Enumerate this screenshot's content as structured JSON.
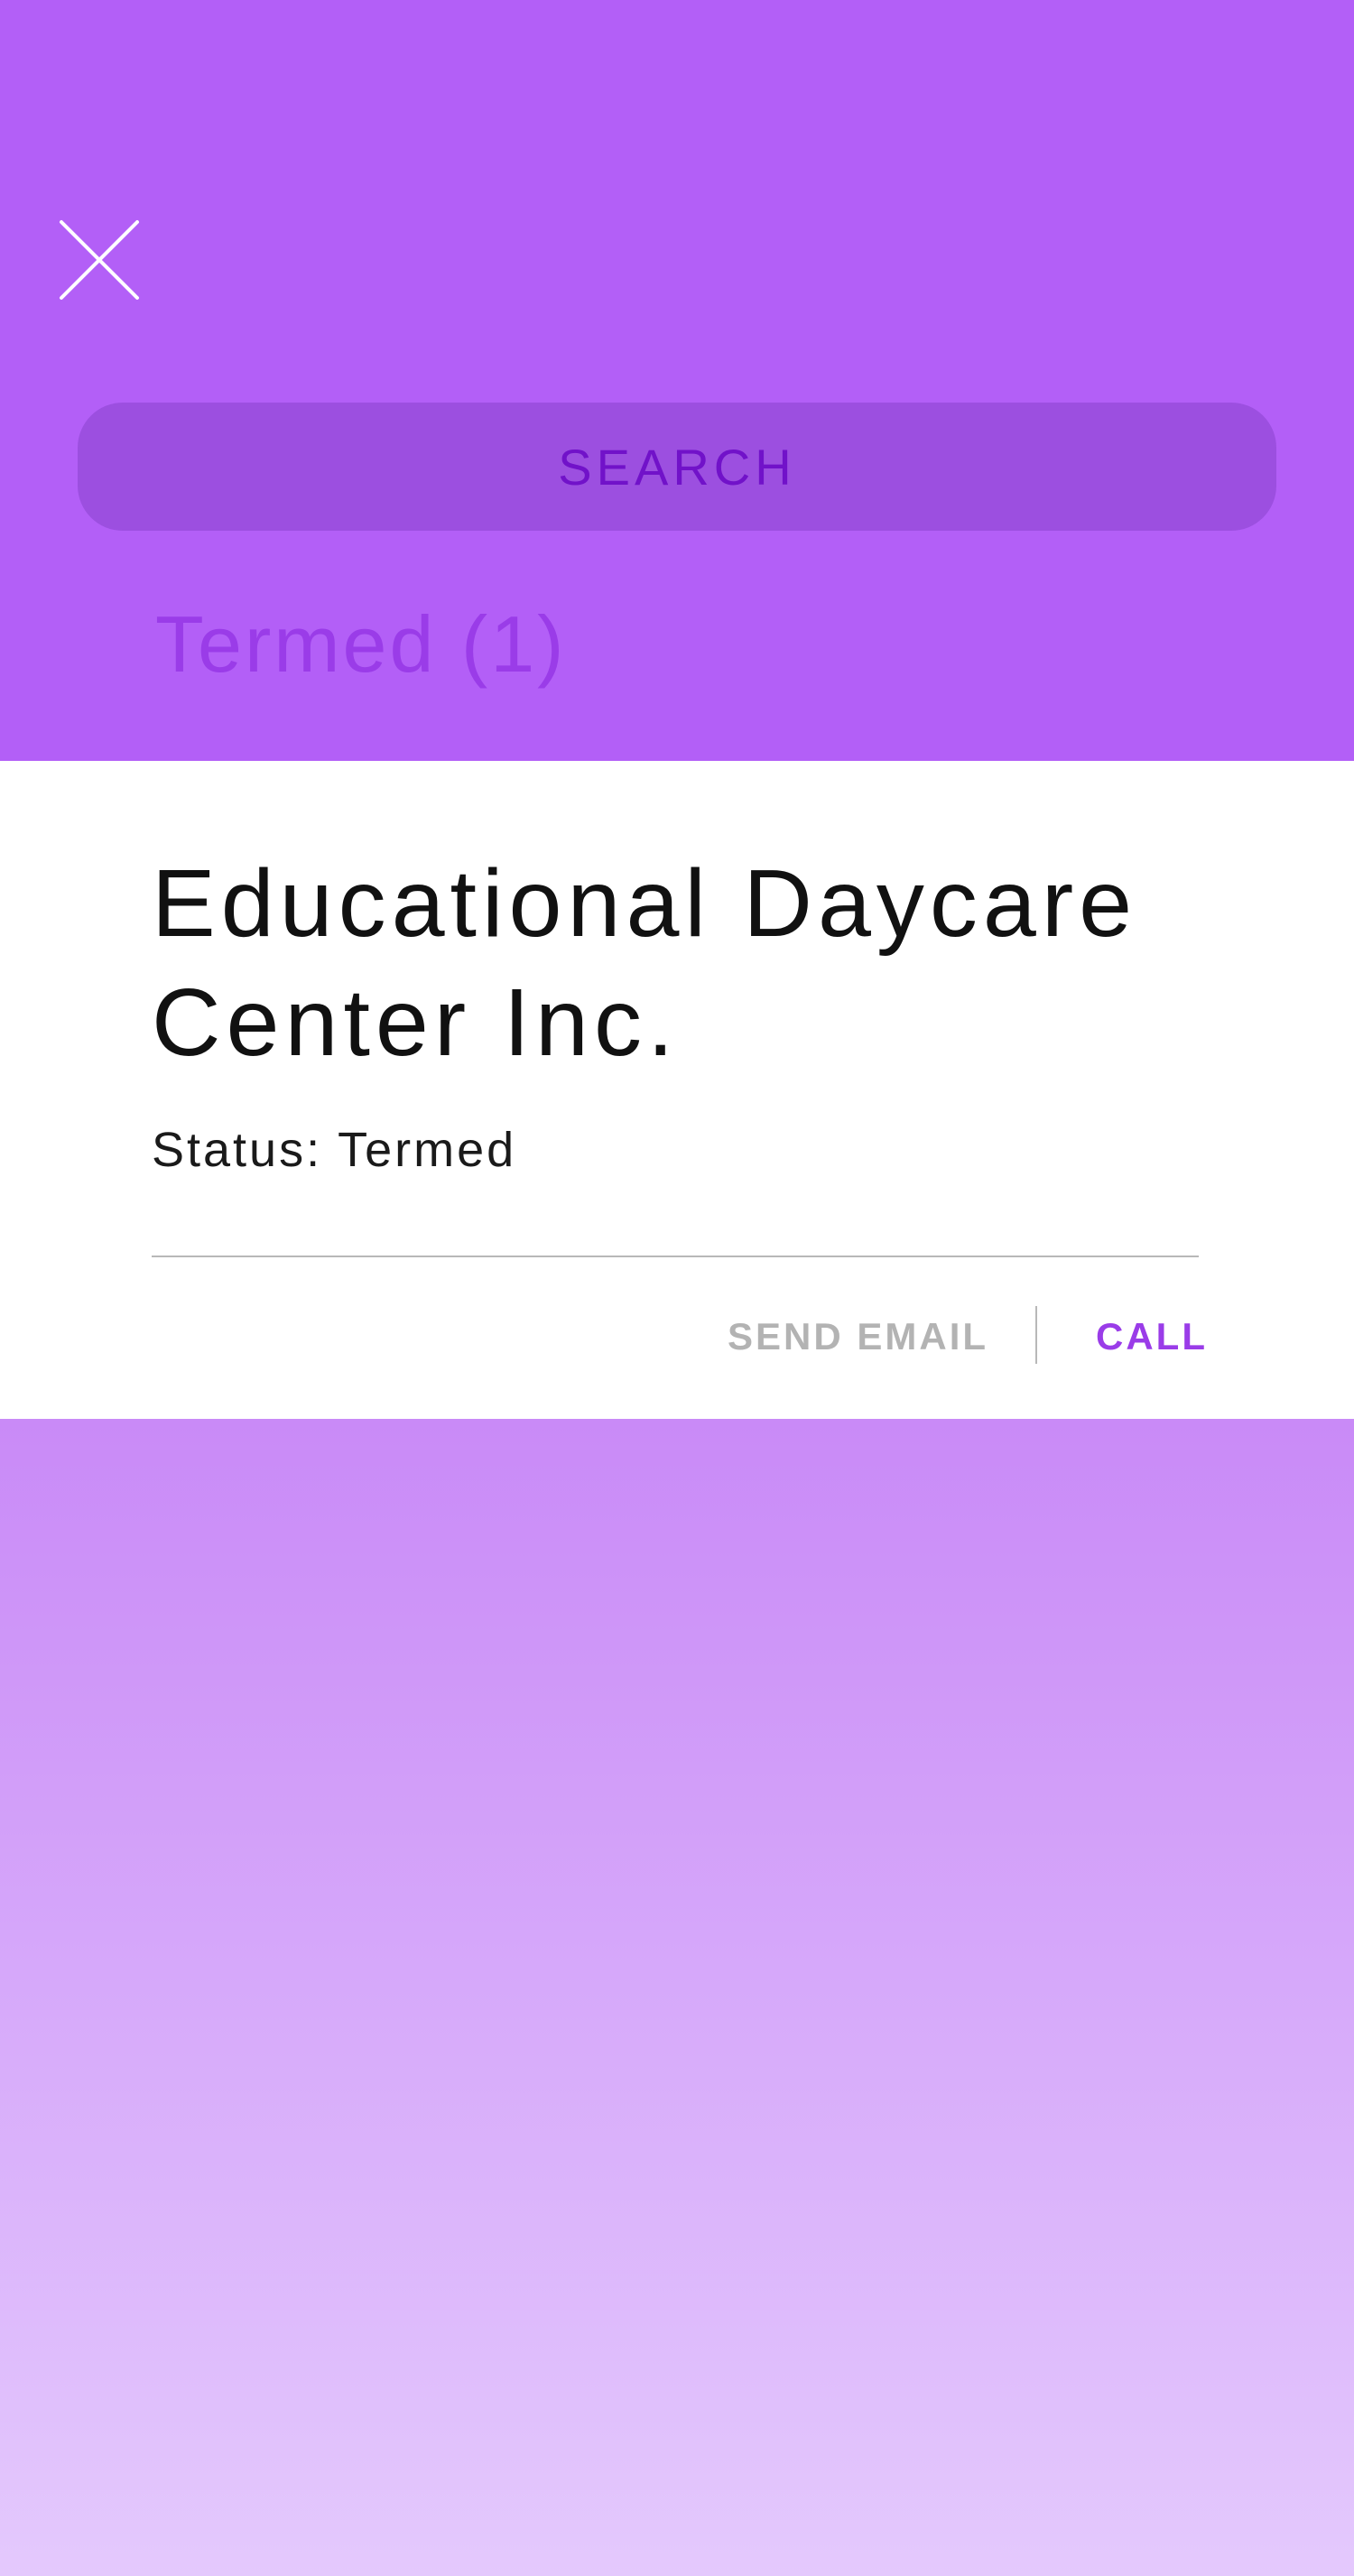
{
  "header": {
    "close_icon": "close-icon",
    "search_label": "SEARCH",
    "section_title": "Termed (1)"
  },
  "card": {
    "title": "Educational Daycare Center Inc.",
    "status": "Status: Termed",
    "actions": {
      "send_email": "SEND EMAIL",
      "call": "CALL"
    }
  },
  "colors": {
    "header_background": "#b35ff7",
    "search_background": "#9c4fe0",
    "search_text": "#7112c9",
    "accent": "#9a3ce8",
    "muted_action": "#b3b3b3",
    "gradient_top": "#c98af7",
    "gradient_bottom": "#e4c9fd"
  }
}
